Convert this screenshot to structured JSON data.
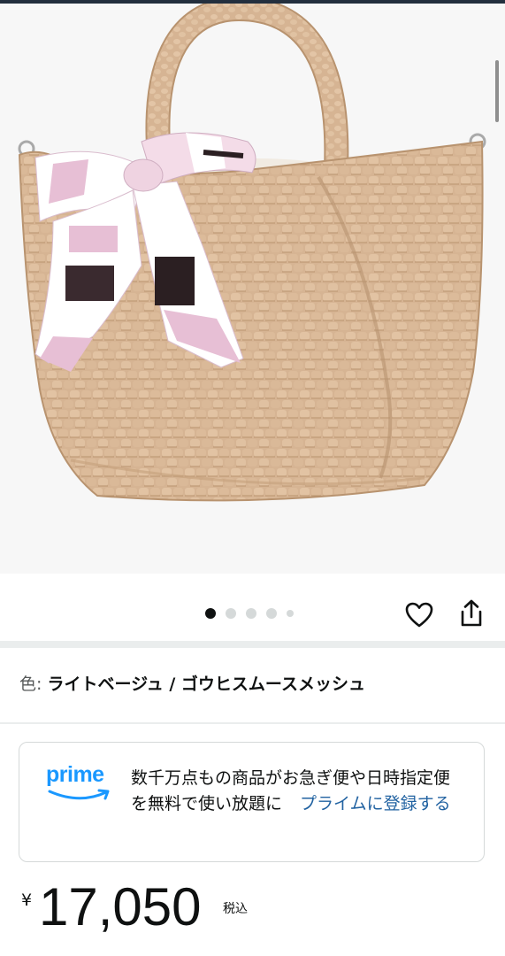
{
  "product": {
    "image_alt": "woven tote bag with pink patterned scarf",
    "carousel": {
      "total": 5,
      "active_index": 0
    },
    "variant": {
      "label": "色:",
      "value": "ライトベージュ / ゴウヒスムースメッシュ"
    }
  },
  "prime": {
    "logo_text": "prime",
    "description": "数千万点もの商品がお急ぎ便や日時指定便を無料で使い放題に",
    "link_text": "プライムに登録する"
  },
  "price": {
    "currency": "¥",
    "amount": "17,050",
    "tax": "税込"
  },
  "icons": {
    "favorite": "heart-icon",
    "share": "share-icon"
  },
  "colors": {
    "prime_blue": "#1a98ff",
    "link_blue": "#2162a1",
    "bag_beige": "#d9b896"
  }
}
